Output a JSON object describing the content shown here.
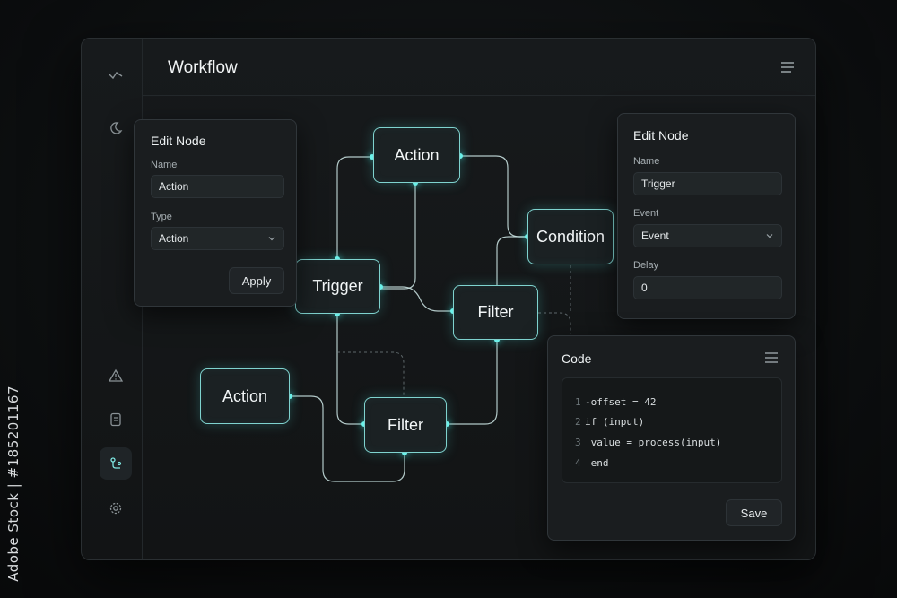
{
  "watermark": {
    "id_text": "Adobe Stock | #185201167"
  },
  "app": {
    "title": "Workflow"
  },
  "icons": {
    "rail": [
      "activity-icon",
      "moon-icon",
      "warning-icon",
      "file-icon",
      "flow-icon",
      "gear-icon"
    ],
    "menu": "menu-icon"
  },
  "nodes": {
    "action_top": "Action",
    "condition": "Condition",
    "trigger": "Trigger",
    "filter_mid": "Filter",
    "action_left": "Action",
    "filter_bottom": "Filter"
  },
  "edit_left": {
    "title": "Edit Node",
    "name_label": "Name",
    "name_value": "Action",
    "type_label": "Type",
    "type_value": "Action",
    "apply_label": "Apply"
  },
  "edit_right": {
    "title": "Edit Node",
    "name_label": "Name",
    "name_value": "Trigger",
    "event_label": "Event",
    "event_value": "Event",
    "delay_label": "Delay",
    "delay_value": "0"
  },
  "code_panel": {
    "title": "Code",
    "lines": [
      {
        "num": "1",
        "text": "-offset = 42"
      },
      {
        "num": "2",
        "text": "if (input)"
      },
      {
        "num": "3",
        "text": " value = process(input)"
      },
      {
        "num": "4",
        "text": " end"
      }
    ],
    "save_label": "Save"
  },
  "colors": {
    "accent": "#6ff4ec",
    "node_border": "#7fd3cf",
    "background": "#0c0e0f",
    "panel": "#1a1d1f"
  }
}
